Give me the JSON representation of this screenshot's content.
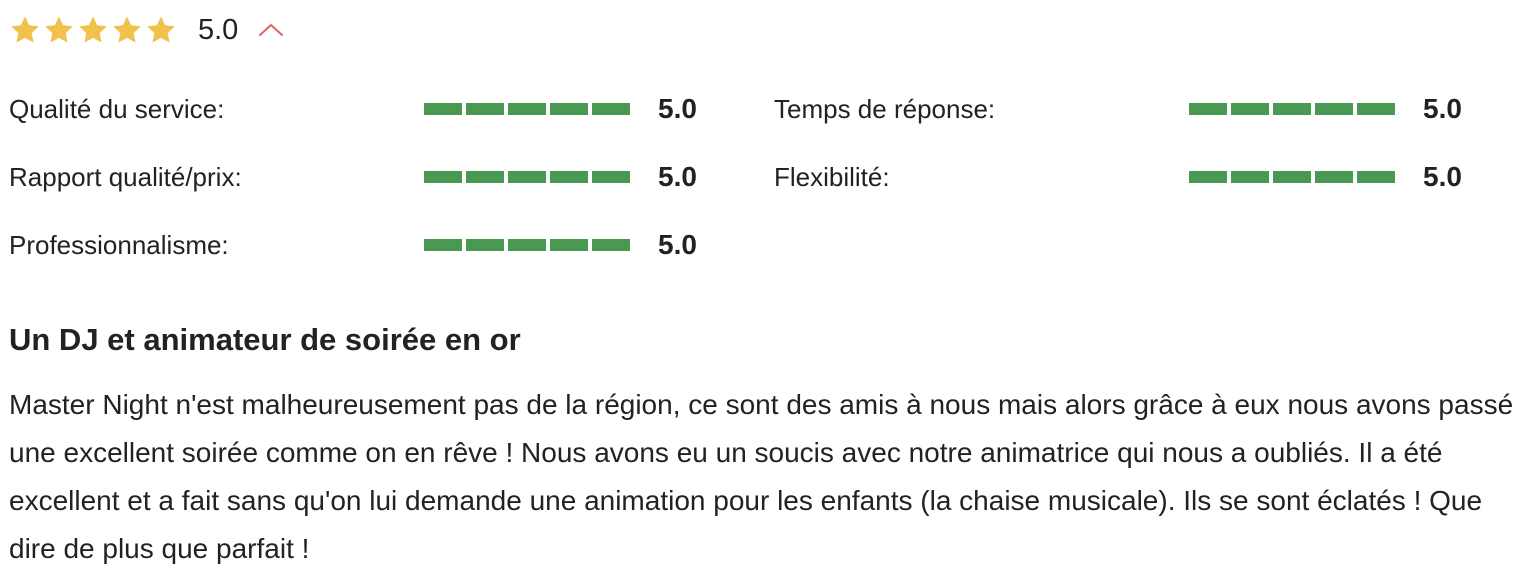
{
  "overall": {
    "stars": 5,
    "max_stars": 5,
    "score": "5.0",
    "star_color": "#f0c14b",
    "toggle_color": "#e0616c"
  },
  "ratings": {
    "bar_color": "#4a9952",
    "segments": 5,
    "items": [
      {
        "label": "Qualité du service:",
        "value": "5.0",
        "level": 5
      },
      {
        "label": "Temps de réponse:",
        "value": "5.0",
        "level": 5
      },
      {
        "label": "Rapport qualité/prix:",
        "value": "5.0",
        "level": 5
      },
      {
        "label": "Flexibilité:",
        "value": "5.0",
        "level": 5
      },
      {
        "label": "Professionnalisme:",
        "value": "5.0",
        "level": 5
      }
    ]
  },
  "review": {
    "title": "Un DJ et animateur de soirée en or",
    "body": "Master Night n'est malheureusement pas de la région, ce sont des amis à nous mais alors grâce à eux nous avons passé une excellent soirée comme on en rêve ! Nous avons eu un soucis avec notre animatrice qui nous a oubliés. Il a été excellent et a fait sans qu'on lui demande une animation pour les enfants (la chaise musicale). Ils se sont éclatés ! Que dire de plus que parfait !"
  }
}
